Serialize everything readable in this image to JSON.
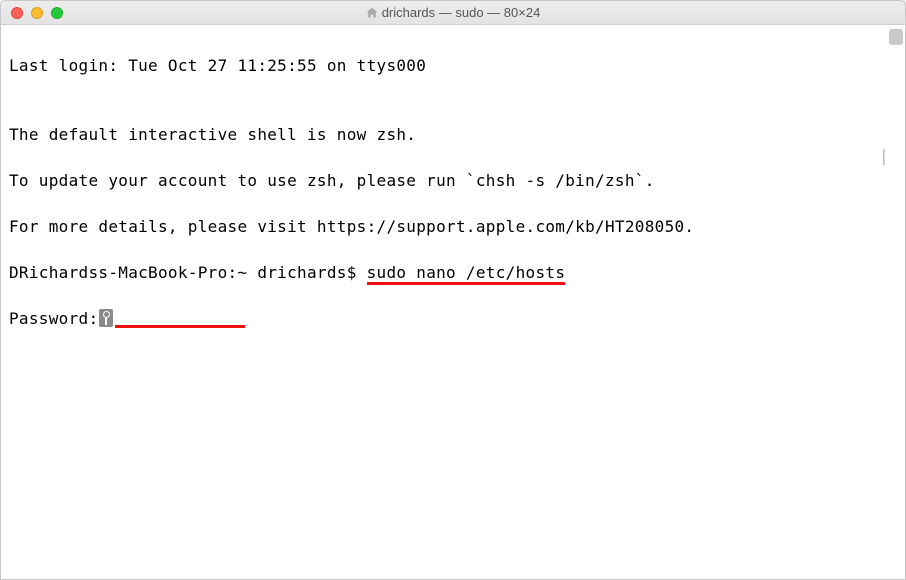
{
  "window": {
    "title": "drichards — sudo — 80×24"
  },
  "terminal": {
    "last_login": "Last login: Tue Oct 27 11:25:55 on ttys000",
    "blank": "",
    "msg1": "The default interactive shell is now zsh.",
    "msg2": "To update your account to use zsh, please run `chsh -s /bin/zsh`.",
    "msg3": "For more details, please visit https://support.apple.com/kb/HT208050.",
    "prompt_prefix": "DRichardss-MacBook-Pro:~ drichards$ ",
    "command": "sudo nano /etc/hosts",
    "password_label": "Password:"
  },
  "annotation": {
    "underline_color": "#e11"
  }
}
